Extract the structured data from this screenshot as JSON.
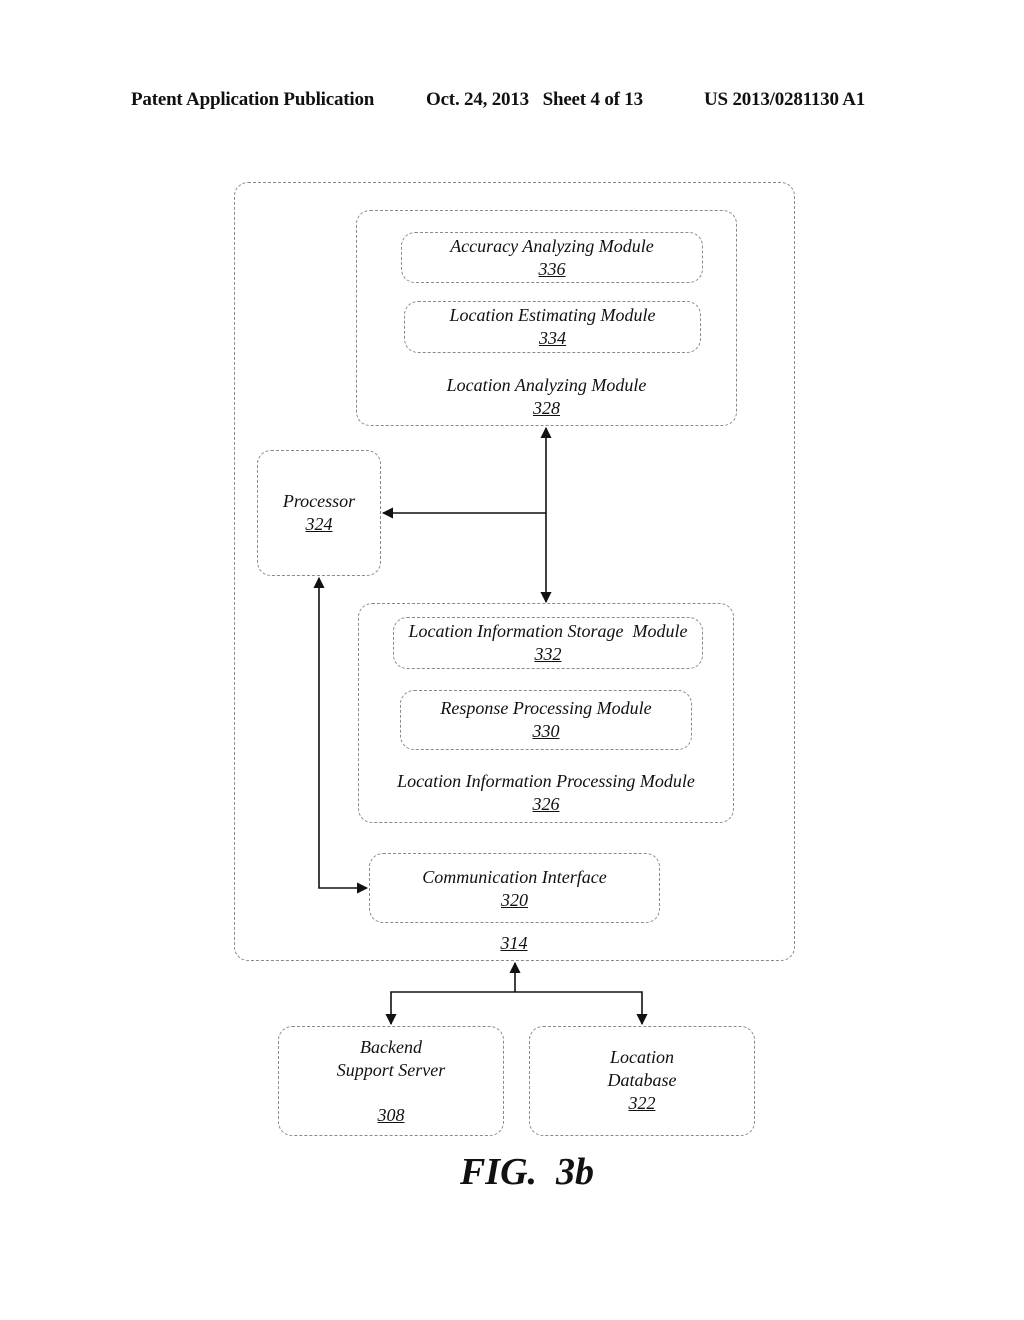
{
  "header": {
    "publication": "Patent Application Publication",
    "date_sheet": "Oct. 24, 2013   Sheet 4 of 13",
    "patent_number": "US 2013/0281130 A1"
  },
  "diagram": {
    "outer_system": {
      "ref": "314"
    },
    "location_analyzing_module": {
      "label": "Location Analyzing Module",
      "ref": "328",
      "children": {
        "accuracy_analyzing_module": {
          "label": "Accuracy Analyzing Module",
          "ref": "336"
        },
        "location_estimating_module": {
          "label": "Location Estimating Module",
          "ref": "334"
        }
      }
    },
    "processor": {
      "label": "Processor",
      "ref": "324"
    },
    "location_information_processing_module": {
      "label": "Location Information Processing Module",
      "ref": "326",
      "children": {
        "location_information_storage_module": {
          "label": "Location Information Storage  Module",
          "ref": "332"
        },
        "response_processing_module": {
          "label": "Response Processing Module",
          "ref": "330"
        }
      }
    },
    "communication_interface": {
      "label": "Communication Interface",
      "ref": "320"
    },
    "backend_support_server": {
      "label_line1": "Backend",
      "label_line2": "Support Server",
      "ref": "308"
    },
    "location_database": {
      "label_line1": "Location",
      "label_line2": "Database",
      "ref": "322"
    }
  },
  "figure_caption": "FIG.  3b"
}
